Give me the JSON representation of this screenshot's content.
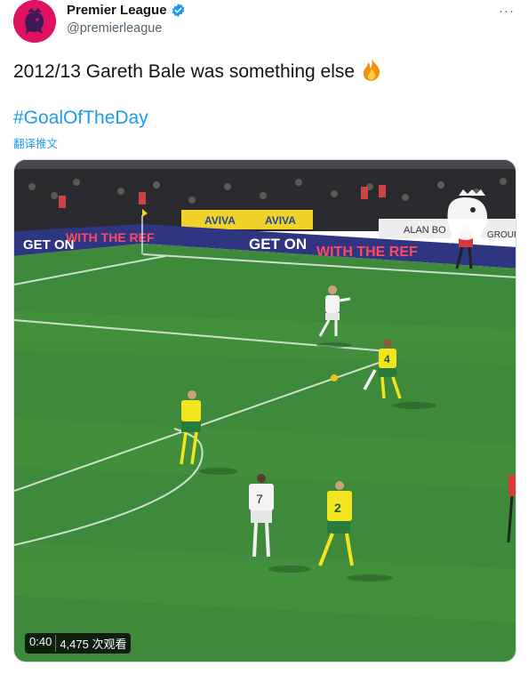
{
  "account": {
    "display_name": "Premier League",
    "handle": "@premierleague",
    "avatar_icon": "premier-league-lion-icon",
    "verified_icon": "verified-badge-icon",
    "verified_color": "#1d9bf0"
  },
  "menu": {
    "label": "···"
  },
  "tweet": {
    "text": "2012/13 Gareth Bale was something else",
    "emoji": "🔥",
    "hashtag": "#GoalOfTheDay",
    "translate_label": "翻译推文"
  },
  "media": {
    "duration": "0:40",
    "views": "4,475 次观看",
    "hoarding": {
      "left_text_1": "GET ON",
      "left_text_2": "WITH THE REF",
      "mid_text_1": "GET ON",
      "mid_text_2": "WITH THE REF",
      "aviva": "AVIVA",
      "alan": "ALAN BO",
      "group": "GROUP"
    },
    "players": {
      "white_7": "7",
      "yellow_4": "4",
      "yellow_2": "2"
    }
  },
  "colors": {
    "accent": "#1d9bf0",
    "text": "#0f1419",
    "muted": "#536471",
    "pitch": "#3f8a3a",
    "brand": "#e0115f"
  }
}
